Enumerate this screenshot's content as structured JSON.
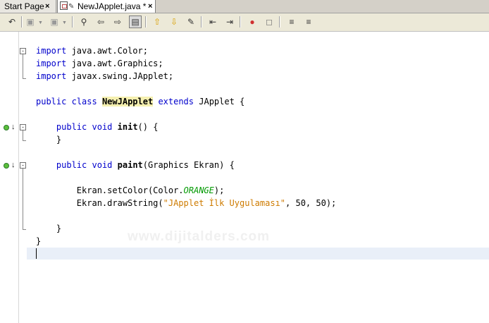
{
  "tabs": [
    {
      "label": "Start Page",
      "close": "×"
    },
    {
      "label": "NewJApplet.java *",
      "close": "×"
    }
  ],
  "toolbar_icons": [
    "back-to-source-icon",
    "run-icon",
    "debug-icon",
    "find-icon",
    "find-prev-icon",
    "find-next-icon",
    "toggle-highlight-icon",
    "prev-bookmark-icon",
    "next-bookmark-icon",
    "toggle-bookmark-icon",
    "shift-left-icon",
    "shift-right-icon",
    "start-macro-icon",
    "stop-macro-icon",
    "comment-icon",
    "uncomment-icon"
  ],
  "code": {
    "l1": {
      "kw": "import",
      "rest": " java.awt.Color;"
    },
    "l2": {
      "kw": "import",
      "rest": " java.awt.Graphics;"
    },
    "l3": {
      "kw": "import",
      "rest": " javax.swing.JApplet;"
    },
    "l5": {
      "kw1": "public",
      "kw2": "class",
      "cls": "NewJApplet",
      "kw3": "extends",
      "rest": " JApplet {"
    },
    "l7": {
      "kw1": "public",
      "kw2": "void",
      "fn": "init",
      "rest": "() {"
    },
    "l8": "}",
    "l10": {
      "kw1": "public",
      "kw2": "void",
      "fn": "paint",
      "rest": "(Graphics Ekran) {"
    },
    "l12": {
      "pre": "Ekran.setColor(Color.",
      "const": "ORANGE",
      "post": ");"
    },
    "l13": {
      "pre": "Ekran.drawString(",
      "str": "\"JApplet İlk Uygulaması\"",
      "post": ", 50, 50);"
    },
    "l15": "}",
    "l16": "}"
  },
  "watermark": "www.dijitalders.com"
}
